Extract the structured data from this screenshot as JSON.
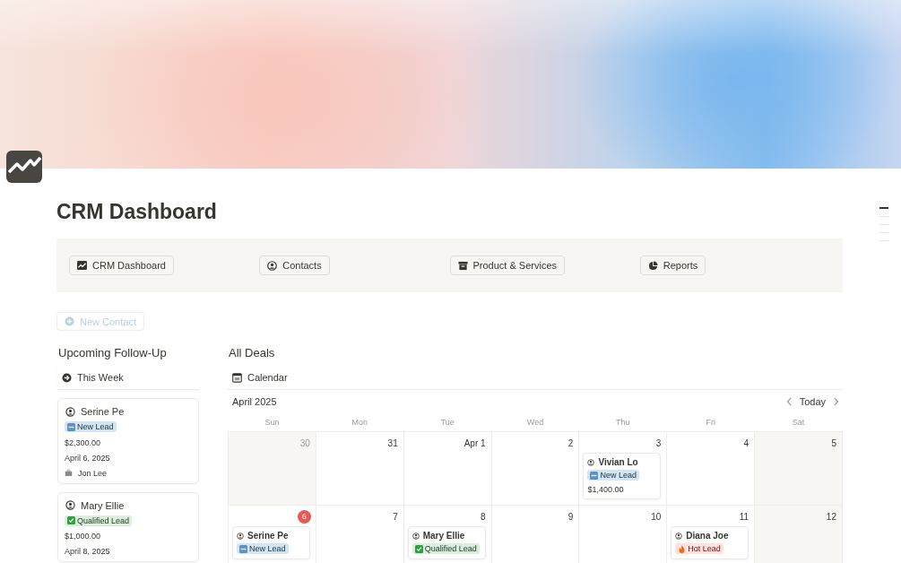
{
  "page": {
    "title": "CRM Dashboard"
  },
  "nav": [
    {
      "label": "CRM Dashboard"
    },
    {
      "label": "Contacts"
    },
    {
      "label": "Product & Services"
    },
    {
      "label": "Reports"
    }
  ],
  "new_button": {
    "label": "New Contact",
    "disabled": true
  },
  "toc": [
    {
      "selected": true
    },
    {
      "selected": false
    },
    {
      "selected": false
    },
    {
      "selected": false
    },
    {
      "selected": false
    }
  ],
  "follow_up": {
    "title": "Upcoming Follow-Up",
    "view": "This Week",
    "cards": [
      {
        "name": "Serine Pe",
        "tag": {
          "label": "New Lead",
          "kind": "new"
        },
        "amount": "$2,300.00",
        "date": "April 6, 2025",
        "owner": "Jon Lee"
      },
      {
        "name": "Mary Ellie",
        "tag": {
          "label": "Qualified Lead",
          "kind": "qualified"
        },
        "amount": "$1,000.00",
        "date": "April 8, 2025"
      }
    ]
  },
  "deals": {
    "title": "All Deals",
    "view": "Calendar",
    "month": "April 2025",
    "today_button": "Today",
    "weekdays": [
      "Sun",
      "Mon",
      "Tue",
      "Wed",
      "Thu",
      "Fri",
      "Sat"
    ],
    "weeks": [
      [
        {
          "day": "30",
          "shaded": true,
          "today": false
        },
        {
          "day": "31",
          "shaded": false,
          "today": false
        },
        {
          "day": "Apr 1",
          "shaded": false,
          "today": false
        },
        {
          "day": "2",
          "shaded": false,
          "today": false
        },
        {
          "day": "3",
          "shaded": false,
          "today": false,
          "deals": [
            {
              "name": "Vivian Lo",
              "tag": {
                "label": "New Lead",
                "kind": "new"
              },
              "amount": "$1,400.00"
            }
          ]
        },
        {
          "day": "4",
          "shaded": false,
          "today": false
        },
        {
          "day": "5",
          "shaded": true,
          "today": false
        }
      ],
      [
        {
          "day": "6",
          "shaded": false,
          "today": true,
          "deals": [
            {
              "name": "Serine Pe",
              "tag": {
                "label": "New Lead",
                "kind": "new"
              }
            }
          ]
        },
        {
          "day": "7",
          "shaded": false,
          "today": false
        },
        {
          "day": "8",
          "shaded": false,
          "today": false,
          "deals": [
            {
              "name": "Mary Ellie",
              "tag": {
                "label": "Qualified Lead",
                "kind": "qualified"
              }
            }
          ]
        },
        {
          "day": "9",
          "shaded": false,
          "today": false
        },
        {
          "day": "10",
          "shaded": false,
          "today": false
        },
        {
          "day": "11",
          "shaded": false,
          "today": false,
          "deals": [
            {
              "name": "Diana Joe",
              "tag": {
                "label": "Hot Lead",
                "kind": "hot"
              }
            }
          ]
        },
        {
          "day": "12",
          "shaded": true,
          "today": false
        }
      ]
    ]
  }
}
